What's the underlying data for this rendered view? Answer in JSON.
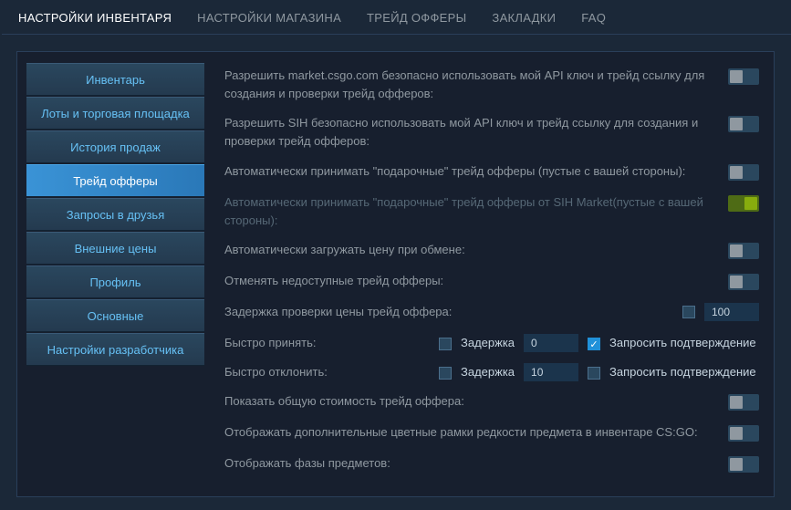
{
  "topnav": [
    {
      "label": "НАСТРОЙКИ ИНВЕНТАРЯ",
      "active": true
    },
    {
      "label": "НАСТРОЙКИ МАГАЗИНА",
      "active": false
    },
    {
      "label": "ТРЕЙД ОФФЕРЫ",
      "active": false
    },
    {
      "label": "ЗАКЛАДКИ",
      "active": false
    },
    {
      "label": "FAQ",
      "active": false
    }
  ],
  "sidebar": [
    {
      "label": "Инвентарь",
      "active": false
    },
    {
      "label": "Лоты и торговая площадка",
      "active": false
    },
    {
      "label": "История продаж",
      "active": false
    },
    {
      "label": "Трейд офферы",
      "active": true
    },
    {
      "label": "Запросы в друзья",
      "active": false
    },
    {
      "label": "Внешние цены",
      "active": false
    },
    {
      "label": "Профиль",
      "active": false
    },
    {
      "label": "Основные",
      "active": false
    },
    {
      "label": "Настройки разработчика",
      "active": false
    }
  ],
  "rows": {
    "r1": "Разрешить market.csgo.com безопасно использовать мой API ключ и трейд ссылку для создания и проверки трейд офферов:",
    "r2": "Разрешить SIH безопасно использовать мой API ключ и трейд ссылку для создания и проверки трейд офферов:",
    "r3": "Автоматически принимать \"подарочные\" трейд офферы (пустые с вашей стороны):",
    "r4": "Автоматически принимать \"подарочные\" трейд офферы от SIH Market(пустые с вашей стороны):",
    "r5": "Автоматически загружать цену при обмене:",
    "r6": "Отменять недоступные трейд офферы:",
    "r7": "Задержка проверки цены трейд оффера:",
    "r7_value": "100",
    "quick_accept": "Быстро принять:",
    "quick_decline": "Быстро отклонить:",
    "delay_label": "Задержка",
    "confirm_label": "Запросить подтверждение",
    "qa_delay_value": "0",
    "qd_delay_value": "10",
    "r10": "Показать общую стоимость трейд оффера:",
    "r11": "Отображать дополнительные цветные рамки редкости предмета в инвентаре CS:GO:",
    "r12": "Отображать фазы предметов:"
  },
  "toggles": {
    "r1": false,
    "r2": false,
    "r3": false,
    "r4": true,
    "r5": false,
    "r6": false,
    "r10": false,
    "r11": false,
    "r12": false
  },
  "checks": {
    "r7": false,
    "qa_delay": false,
    "qa_confirm": true,
    "qd_delay": false,
    "qd_confirm": false
  }
}
